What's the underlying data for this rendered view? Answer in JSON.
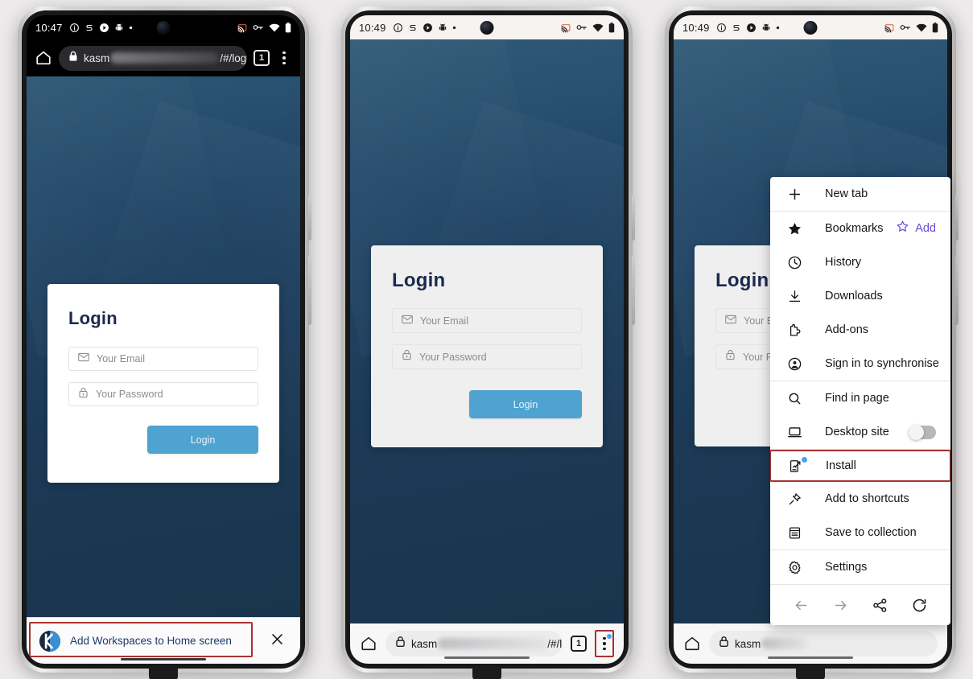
{
  "meta": {
    "accent_blue": "#4fa3d1",
    "wallpaper_navy": "#1c3a56",
    "highlight_red": "#a83232",
    "firefox_purple": "#6a46d9",
    "badge_blue": "#45a1ff"
  },
  "phones": [
    {
      "id": "phone-1",
      "status_bar": {
        "clock": "10:47",
        "theme": "dark",
        "left_icons": [
          "info-icon",
          "s-notification-icon",
          "play-circle-icon",
          "android-robot-icon",
          "more-dot-icon"
        ],
        "right_icons": [
          "cast-icon",
          "vpn-key-icon",
          "wifi-icon",
          "battery-icon"
        ]
      },
      "browser_top_bar": {
        "home_icon": "home-icon",
        "lock_icon": "lock-icon",
        "url_prefix": "kasm",
        "url_redacted": true,
        "url_suffix": "/#/login",
        "tab_count": "1",
        "menu_icon": "kebab-menu-icon"
      },
      "login_card": {
        "title": "Login",
        "card_background": "#ffffff",
        "email_placeholder": "Your Email",
        "email_value": "",
        "email_icon": "envelope-icon",
        "password_placeholder": "Your Password",
        "password_value": "",
        "password_icon": "lock-icon",
        "submit_label": "Login"
      },
      "install_banner": {
        "logo_icon": "kasm-logo-icon",
        "text": "Add Workspaces to Home screen",
        "close_icon": "close-icon",
        "highlighted": true
      }
    },
    {
      "id": "phone-2",
      "status_bar": {
        "clock": "10:49",
        "theme": "light",
        "left_icons": [
          "info-icon",
          "s-notification-icon",
          "play-circle-icon",
          "android-robot-icon",
          "more-dot-icon"
        ],
        "right_icons": [
          "cast-icon",
          "vpn-key-icon",
          "wifi-icon",
          "battery-icon"
        ]
      },
      "login_card": {
        "title": "Login",
        "card_background": "#efefef",
        "email_placeholder": "Your Email",
        "email_value": "",
        "email_icon": "envelope-icon",
        "password_placeholder": "Your Password",
        "password_value": "",
        "password_icon": "lock-icon",
        "submit_label": "Login"
      },
      "browser_bottom_bar": {
        "home_icon": "home-icon",
        "lock_icon": "lock-icon",
        "url_prefix": "kasm",
        "url_redacted": true,
        "url_suffix": "/#/login",
        "tab_count": "1",
        "menu_icon": "kebab-menu-icon",
        "menu_badge": true,
        "menu_highlighted": true
      }
    },
    {
      "id": "phone-3",
      "status_bar": {
        "clock": "10:49",
        "theme": "light",
        "left_icons": [
          "info-icon",
          "s-notification-icon",
          "play-circle-icon",
          "android-robot-icon",
          "more-dot-icon"
        ],
        "right_icons": [
          "cast-icon",
          "vpn-key-icon",
          "wifi-icon",
          "battery-icon"
        ]
      },
      "login_card": {
        "title": "Login",
        "card_background": "#efefef",
        "email_placeholder": "Your Em",
        "email_icon": "envelope-icon",
        "password_placeholder": "Your Pa",
        "password_icon": "lock-icon"
      },
      "browser_bottom_bar": {
        "home_icon": "home-icon",
        "lock_icon": "lock-icon",
        "url_prefix": "kasm",
        "url_redacted": true
      },
      "menu": {
        "items": [
          {
            "icon": "plus-icon",
            "label": "New tab"
          },
          {
            "icon": "star-filled-icon",
            "label": "Bookmarks",
            "action_icon": "star-outline-icon",
            "action_label": "Add"
          },
          {
            "icon": "clock-icon",
            "label": "History"
          },
          {
            "icon": "download-icon",
            "label": "Downloads"
          },
          {
            "icon": "puzzle-icon",
            "label": "Add-ons"
          },
          {
            "icon": "account-circle-icon",
            "label": "Sign in to synchronise"
          },
          {
            "icon": "search-icon",
            "label": "Find in page"
          },
          {
            "icon": "laptop-icon",
            "label": "Desktop site",
            "toggle": "off"
          },
          {
            "icon": "install-app-icon",
            "label": "Install",
            "badge": true,
            "highlighted": true
          },
          {
            "icon": "pin-icon",
            "label": "Add to shortcuts"
          },
          {
            "icon": "collection-icon",
            "label": "Save to collection"
          },
          {
            "icon": "gear-icon",
            "label": "Settings"
          }
        ],
        "footer_icons": [
          "back-arrow-icon",
          "forward-arrow-icon",
          "share-icon",
          "reload-icon"
        ]
      }
    }
  ]
}
